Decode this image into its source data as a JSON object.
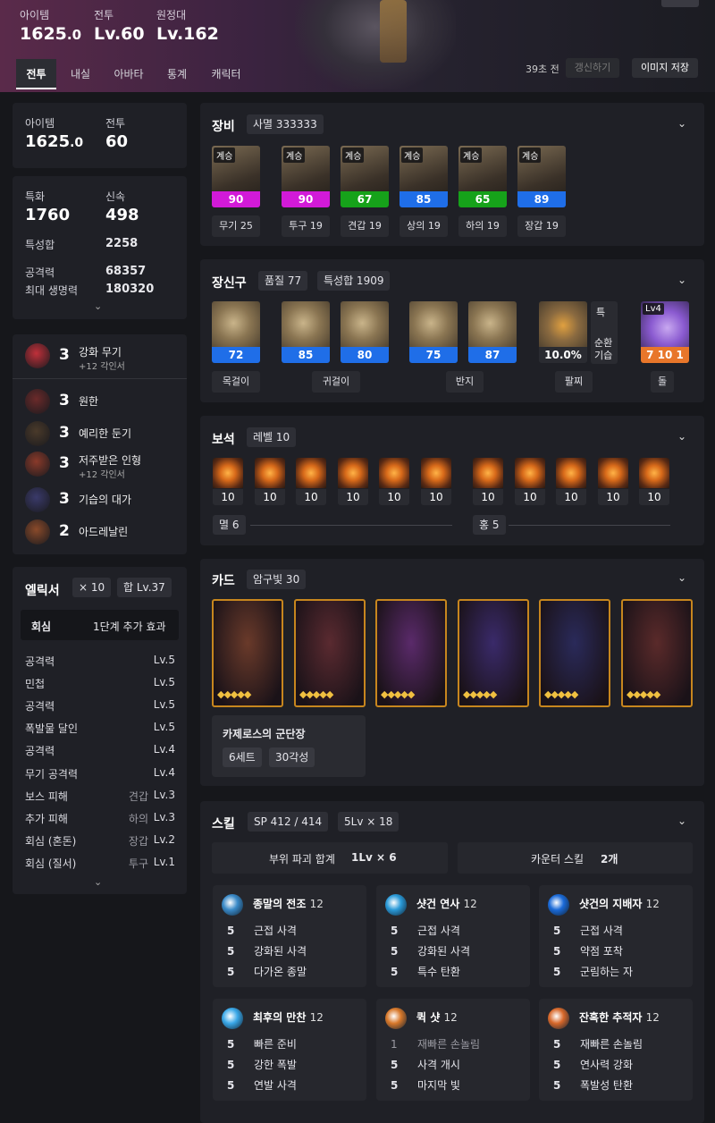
{
  "header": {
    "item_level_label": "아이템",
    "item_level_main": "1625",
    "item_level_dec": ".0",
    "combat_label": "전투",
    "combat_value": "Lv.60",
    "expedition_label": "원정대",
    "expedition_value": "Lv.162",
    "top_right_text": "...",
    "tabs": [
      "전투",
      "내실",
      "아바타",
      "통계",
      "캐릭터"
    ],
    "refresh_time": "39초 전",
    "refresh_button": "갱신하기",
    "save_image_button": "이미지 저장"
  },
  "summary": {
    "item_label": "아이템",
    "item_main": "1625",
    "item_dec": ".0",
    "combat_label": "전투",
    "combat_value": "60"
  },
  "stats": {
    "crit_label": "특화",
    "crit_value": "1760",
    "swift_label": "신속",
    "swift_value": "498",
    "total_label": "특성합",
    "total_value": "2258",
    "attack_label": "공격력",
    "attack_value": "68357",
    "hp_label": "최대 생명력",
    "hp_value": "180320"
  },
  "engravings": [
    {
      "count": "3",
      "name": "강화 무기",
      "sub": "+12 각인서",
      "color": "#c0303a"
    },
    {
      "count": "3",
      "name": "원한",
      "sub": "",
      "color": "#6b2a2a"
    },
    {
      "count": "3",
      "name": "예리한 둔기",
      "sub": "",
      "color": "#4a3a2a"
    },
    {
      "count": "3",
      "name": "저주받은 인형",
      "sub": "+12 각인서",
      "color": "#8a3a2a"
    },
    {
      "count": "3",
      "name": "기습의 대가",
      "sub": "",
      "color": "#3a3a6a"
    },
    {
      "count": "2",
      "name": "아드레날린",
      "sub": "",
      "color": "#8a4a2a"
    }
  ],
  "elixir": {
    "title": "엘릭서",
    "count_chip": "× 10",
    "sum_chip": "합 Lv.37",
    "set_name": "회심",
    "set_effect": "1단계 추가 효과",
    "rows": [
      {
        "name": "공격력",
        "part": "",
        "lv": "Lv.5"
      },
      {
        "name": "민첩",
        "part": "",
        "lv": "Lv.5"
      },
      {
        "name": "공격력",
        "part": "",
        "lv": "Lv.5"
      },
      {
        "name": "폭발물 달인",
        "part": "",
        "lv": "Lv.5"
      },
      {
        "name": "공격력",
        "part": "",
        "lv": "Lv.4"
      },
      {
        "name": "무기 공격력",
        "part": "",
        "lv": "Lv.4"
      },
      {
        "name": "보스 피해",
        "part": "견갑",
        "lv": "Lv.3"
      },
      {
        "name": "추가 피해",
        "part": "하의",
        "lv": "Lv.3"
      },
      {
        "name": "회심 (혼돈)",
        "part": "장갑",
        "lv": "Lv.2"
      },
      {
        "name": "회심 (질서)",
        "part": "투구",
        "lv": "Lv.1"
      }
    ]
  },
  "equipment": {
    "title": "장비",
    "set_chip": "사멸 333333",
    "inherit_tag": "계승",
    "items": [
      {
        "quality": "90",
        "slot": "무기 25",
        "color": "#d21ad8"
      },
      {
        "quality": "90",
        "slot": "투구 19",
        "color": "#d21ad8"
      },
      {
        "quality": "67",
        "slot": "견갑 19",
        "color": "#16a21a"
      },
      {
        "quality": "85",
        "slot": "상의 19",
        "color": "#1f6ee8"
      },
      {
        "quality": "65",
        "slot": "하의 19",
        "color": "#16a21a"
      },
      {
        "quality": "89",
        "slot": "장갑 19",
        "color": "#1f6ee8"
      }
    ]
  },
  "accessories": {
    "title": "장신구",
    "quality_chip": "품질 77",
    "stat_chip": "특성합 1909",
    "items": [
      {
        "quality": "72",
        "color": "#1f6ee8"
      },
      {
        "quality": "85",
        "color": "#1f6ee8"
      },
      {
        "quality": "80",
        "color": "#1f6ee8"
      },
      {
        "quality": "75",
        "color": "#1f6ee8"
      },
      {
        "quality": "87",
        "color": "#1f6ee8"
      }
    ],
    "bracelet_value": "10.0%",
    "bracelet_side": [
      "특",
      "순환",
      "기습"
    ],
    "stone_level": "Lv4",
    "stone_value": "7 10 1",
    "labels": [
      "목걸이",
      "귀걸이",
      "반지",
      "팔찌",
      "돌"
    ]
  },
  "gems": {
    "title": "보석",
    "level_chip": "레벨 10",
    "values": [
      "10",
      "10",
      "10",
      "10",
      "10",
      "10",
      "10",
      "10",
      "10",
      "10",
      "10"
    ],
    "left_label": "멸 6",
    "right_label": "홍 5"
  },
  "cards": {
    "title": "카드",
    "awaken_chip": "암구빛 30",
    "set_name": "카제로스의 군단장",
    "set_chip": "6세트",
    "awaken_total": "30각성",
    "stars": "◆◆◆◆◆",
    "palette": [
      "#6a3a2a",
      "#5a2a30",
      "#5a2a6a",
      "#3a2a6a",
      "#2a2a5a",
      "#5a2a2a"
    ]
  },
  "skills": {
    "title": "스킬",
    "sp_chip": "SP 412 / 414",
    "lv_chip": "5Lv × 18",
    "destroy_label": "부위 파괴 합계",
    "destroy_value": "1Lv × 6",
    "counter_label": "카운터 스킬",
    "counter_value": "2개",
    "list": [
      {
        "name": "종말의 전조",
        "lv": "12",
        "color": "#3a8ac8",
        "tripods": [
          [
            "5",
            "근접 사격"
          ],
          [
            "5",
            "강화된 사격"
          ],
          [
            "5",
            "다가온 종말"
          ]
        ]
      },
      {
        "name": "샷건 연사",
        "lv": "12",
        "color": "#2a9ad8",
        "tripods": [
          [
            "5",
            "근접 사격"
          ],
          [
            "5",
            "강화된 사격"
          ],
          [
            "5",
            "특수 탄환"
          ]
        ]
      },
      {
        "name": "샷건의 지배자",
        "lv": "12",
        "color": "#1a6ad8",
        "tripods": [
          [
            "5",
            "근접 사격"
          ],
          [
            "5",
            "약점 포착"
          ],
          [
            "5",
            "군림하는 자"
          ]
        ]
      },
      {
        "name": "최후의 만찬",
        "lv": "12",
        "color": "#3aa8e8",
        "tripods": [
          [
            "5",
            "빠른 준비"
          ],
          [
            "5",
            "강한 폭발"
          ],
          [
            "5",
            "연발 사격"
          ]
        ]
      },
      {
        "name": "퀵 샷",
        "lv": "12",
        "color": "#d8782a",
        "tripods": [
          [
            "1",
            "재빠른 손놀림"
          ],
          [
            "5",
            "사격 개시"
          ],
          [
            "5",
            "마지막 빛"
          ]
        ]
      },
      {
        "name": "잔혹한 추적자",
        "lv": "12",
        "color": "#d8682a",
        "tripods": [
          [
            "5",
            "재빠른 손놀림"
          ],
          [
            "5",
            "연사력 강화"
          ],
          [
            "5",
            "폭발성 탄환"
          ]
        ]
      }
    ]
  }
}
